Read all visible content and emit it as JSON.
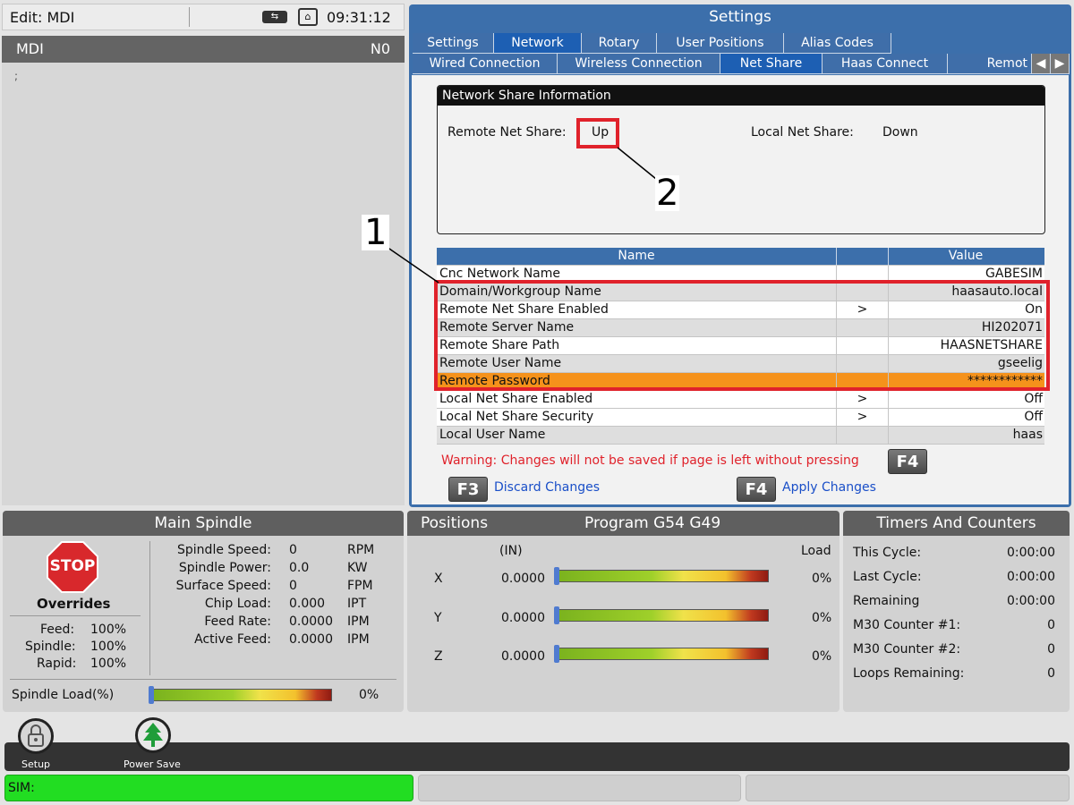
{
  "topbar": {
    "title": "Edit: MDI",
    "clock": "09:31:12"
  },
  "mdi": {
    "title": "MDI",
    "n_label": "N0",
    "cursor": ";"
  },
  "settings": {
    "title": "Settings",
    "tabs_row1": [
      "Settings",
      "Network",
      "Rotary",
      "User Positions",
      "Alias Codes"
    ],
    "tabs_row2": [
      "Wired Connection",
      "Wireless Connection",
      "Net Share",
      "Haas Connect",
      "Remot"
    ],
    "nsi": {
      "header": "Network Share Information",
      "remote_label": "Remote Net Share:",
      "remote_value": "Up",
      "local_label": "Local Net Share:",
      "local_value": "Down"
    },
    "grid_header": {
      "name": "Name",
      "value": "Value"
    },
    "rows": [
      {
        "name": "Cnc Network Name",
        "arrow": "",
        "value": "GABESIM"
      },
      {
        "name": "Domain/Workgroup Name",
        "arrow": "",
        "value": "haasauto.local"
      },
      {
        "name": "Remote Net Share Enabled",
        "arrow": ">",
        "value": "On"
      },
      {
        "name": "Remote Server Name",
        "arrow": "",
        "value": "HI202071"
      },
      {
        "name": "Remote Share Path",
        "arrow": "",
        "value": "HAASNETSHARE"
      },
      {
        "name": "Remote User Name",
        "arrow": "",
        "value": "gseelig"
      },
      {
        "name": "Remote Password",
        "arrow": "",
        "value": "************"
      },
      {
        "name": "Local Net Share Enabled",
        "arrow": ">",
        "value": "Off"
      },
      {
        "name": "Local Net Share Security",
        "arrow": ">",
        "value": "Off"
      },
      {
        "name": "Local User Name",
        "arrow": "",
        "value": "haas"
      }
    ],
    "warning": "Warning: Changes will not be saved if page is left without pressing",
    "f4_label": "F4",
    "f3_label": "F3",
    "discard": "Discard Changes",
    "apply": "Apply Changes",
    "callout_1": "1",
    "callout_2": "2"
  },
  "spindle": {
    "title": "Main Spindle",
    "stop": "STOP",
    "overrides": "Overrides",
    "feed_label": "Feed:",
    "feed_value": "100%",
    "spindle_label": "Spindle:",
    "spindle_value": "100%",
    "rapid_label": "Rapid:",
    "rapid_value": "100%",
    "stats": [
      {
        "label": "Spindle Speed:",
        "value": "0",
        "unit": "RPM"
      },
      {
        "label": "Spindle Power:",
        "value": "0.0",
        "unit": "KW"
      },
      {
        "label": "Surface Speed:",
        "value": "0",
        "unit": "FPM"
      },
      {
        "label": "Chip Load:",
        "value": "0.000",
        "unit": "IPT"
      },
      {
        "label": "Feed Rate:",
        "value": "0.0000",
        "unit": "IPM"
      },
      {
        "label": "Active Feed:",
        "value": "0.0000",
        "unit": "IPM"
      }
    ],
    "load_label": "Spindle Load(%)",
    "load_value": "0%"
  },
  "positions": {
    "title": "Positions",
    "program": "Program G54 G49",
    "unit": "(IN)",
    "load_header": "Load",
    "axes": [
      {
        "axis": "X",
        "value": "0.0000",
        "load": "0%"
      },
      {
        "axis": "Y",
        "value": "0.0000",
        "load": "0%"
      },
      {
        "axis": "Z",
        "value": "0.0000",
        "load": "0%"
      }
    ]
  },
  "timers": {
    "title": "Timers And Counters",
    "rows": [
      {
        "label": "This Cycle:",
        "value": "0:00:00"
      },
      {
        "label": "Last Cycle:",
        "value": "0:00:00"
      },
      {
        "label": "Remaining",
        "value": "0:00:00"
      },
      {
        "label": "M30 Counter #1:",
        "value": "0"
      },
      {
        "label": "M30 Counter #2:",
        "value": "0"
      },
      {
        "label": "Loops Remaining:",
        "value": "0"
      }
    ]
  },
  "dock": {
    "setup": "Setup",
    "power_save": "Power Save"
  },
  "statusbar": {
    "sim": "SIM:"
  },
  "colors": {
    "accent": "#3c6fab",
    "tab_selected": "#1d5fb3",
    "highlight": "#f5921b",
    "callout": "#e0222b",
    "sim_green": "#22dd22"
  }
}
